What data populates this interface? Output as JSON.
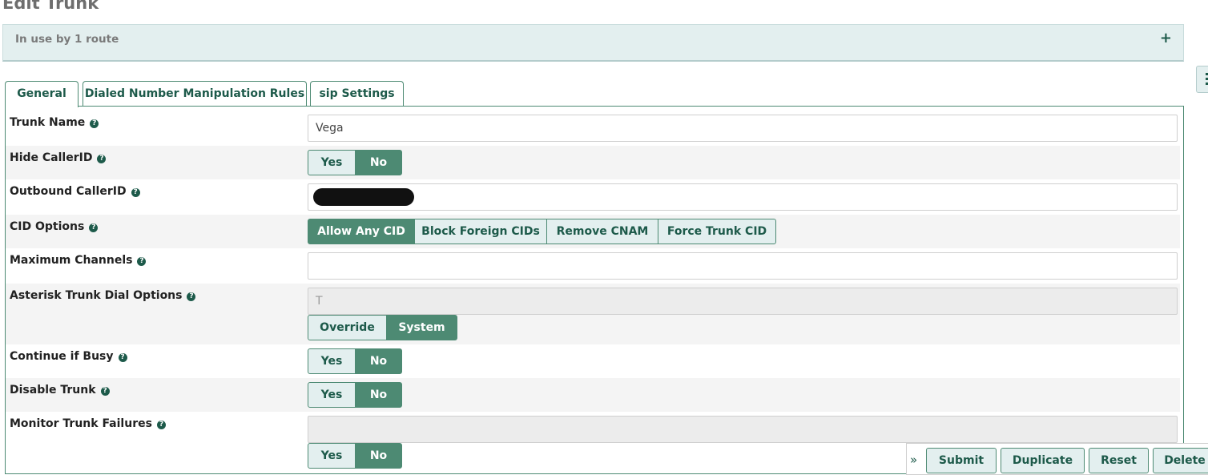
{
  "page": {
    "title": "Edit Trunk"
  },
  "usage_panel": {
    "text": "In use by 1 route",
    "toggle": "+"
  },
  "tabs": [
    {
      "label": "General",
      "active": true
    },
    {
      "label": "Dialed Number Manipulation Rules",
      "active": false
    },
    {
      "label": "sip Settings",
      "active": false
    }
  ],
  "help_glyph": "?",
  "form": {
    "trunk_name": {
      "label": "Trunk Name",
      "value": "Vega"
    },
    "hide_callerid": {
      "label": "Hide CallerID",
      "options": [
        "Yes",
        "No"
      ],
      "selected": "No"
    },
    "outbound_callerid": {
      "label": "Outbound CallerID",
      "value": ""
    },
    "cid_options": {
      "label": "CID Options",
      "options": [
        "Allow Any CID",
        "Block Foreign CIDs",
        "Remove CNAM",
        "Force Trunk CID"
      ],
      "selected": "Allow Any CID"
    },
    "max_channels": {
      "label": "Maximum Channels",
      "value": ""
    },
    "dial_options": {
      "label": "Asterisk Trunk Dial Options",
      "value": "T",
      "options": [
        "Override",
        "System"
      ],
      "selected": "System"
    },
    "continue_if_busy": {
      "label": "Continue if Busy",
      "options": [
        "Yes",
        "No"
      ],
      "selected": "No"
    },
    "disable_trunk": {
      "label": "Disable Trunk",
      "options": [
        "Yes",
        "No"
      ],
      "selected": "No"
    },
    "monitor_failures": {
      "label": "Monitor Trunk Failures",
      "value": "",
      "options": [
        "Yes",
        "No"
      ],
      "selected": "No"
    }
  },
  "actions": {
    "chevron": "»",
    "submit": "Submit",
    "duplicate": "Duplicate",
    "reset": "Reset",
    "delete": "Delete"
  },
  "colors": {
    "accent": "#4d8a73",
    "accent_dark": "#1d5a4a",
    "panel_bg": "#e3efef"
  }
}
